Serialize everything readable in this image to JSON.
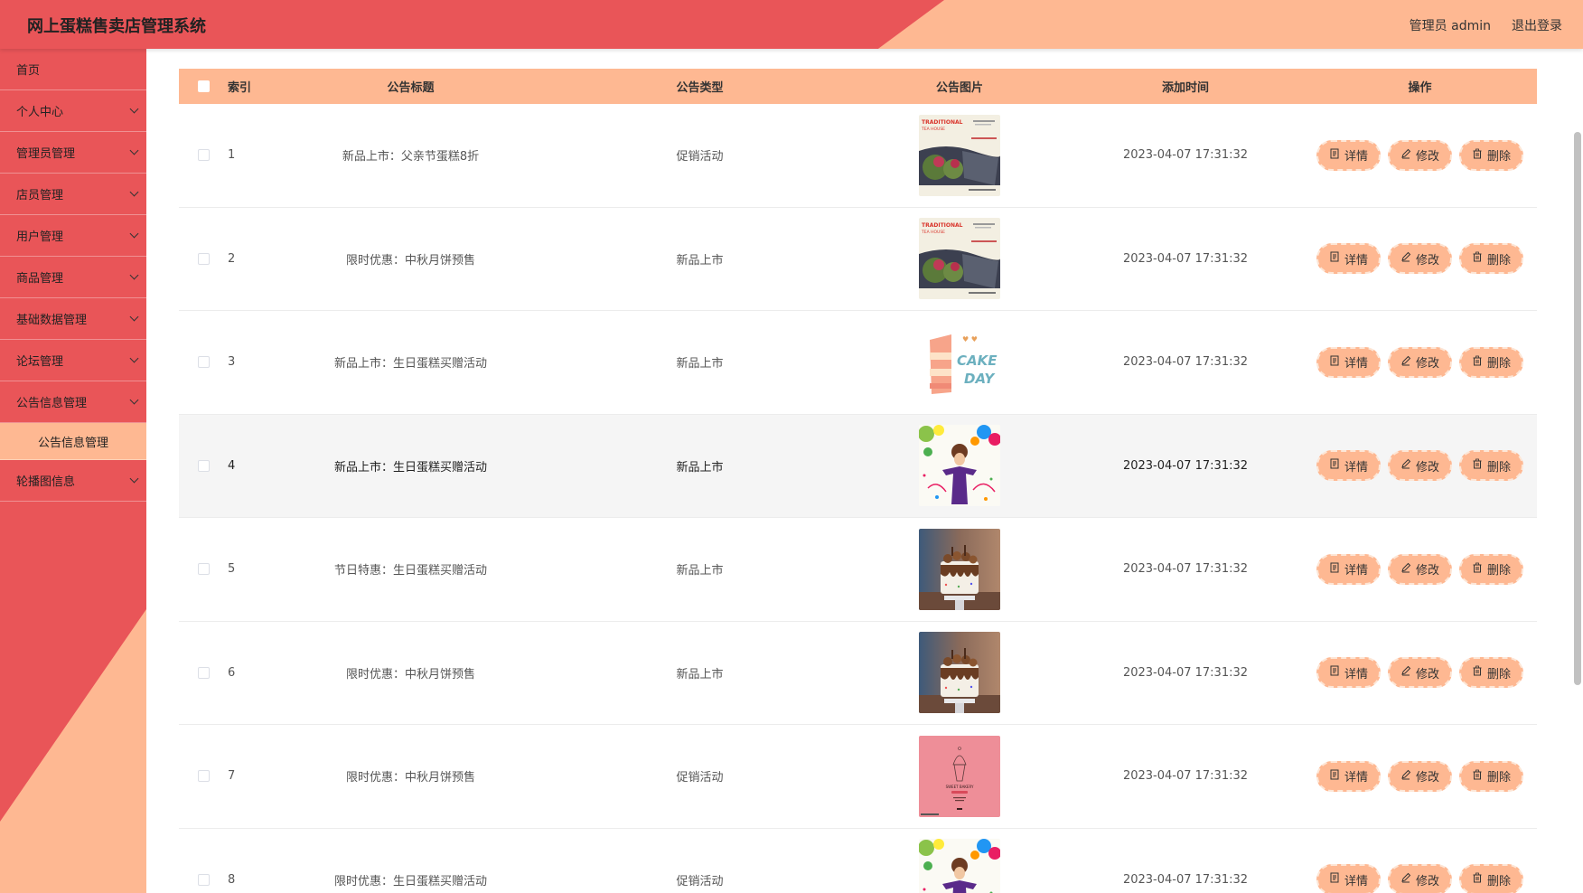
{
  "header": {
    "title": "网上蛋糕售卖店管理系统",
    "user": "管理员 admin",
    "logout": "退出登录"
  },
  "sidebar": {
    "items": [
      {
        "label": "首页",
        "has_children": false
      },
      {
        "label": "个人中心",
        "has_children": true
      },
      {
        "label": "管理员管理",
        "has_children": true
      },
      {
        "label": "店员管理",
        "has_children": true
      },
      {
        "label": "用户管理",
        "has_children": true
      },
      {
        "label": "商品管理",
        "has_children": true
      },
      {
        "label": "基础数据管理",
        "has_children": true
      },
      {
        "label": "论坛管理",
        "has_children": true
      },
      {
        "label": "公告信息管理",
        "has_children": true
      },
      {
        "label": "轮播图信息",
        "has_children": true
      }
    ],
    "submenu": {
      "label": "公告信息管理"
    }
  },
  "table": {
    "columns": [
      "索引",
      "公告标题",
      "公告类型",
      "公告图片",
      "添加时间",
      "操作"
    ],
    "rows": [
      {
        "index": "1",
        "title": "新品上市：父亲节蛋糕8折",
        "type": "促销活动",
        "image": "tea-house-poster",
        "time": "2023-04-07 17:31:32"
      },
      {
        "index": "2",
        "title": "限时优惠：中秋月饼预售",
        "type": "新品上市",
        "image": "tea-house-poster",
        "time": "2023-04-07 17:31:32"
      },
      {
        "index": "3",
        "title": "新品上市：生日蛋糕买赠活动",
        "type": "新品上市",
        "image": "cake-day-illustration",
        "time": "2023-04-07 17:31:32"
      },
      {
        "index": "4",
        "title": "新品上市：生日蛋糕买赠活动",
        "type": "新品上市",
        "image": "party-girl-photo",
        "time": "2023-04-07 17:31:32"
      },
      {
        "index": "5",
        "title": "节日特惠：生日蛋糕买赠活动",
        "type": "新品上市",
        "image": "chocolate-cake-photo",
        "time": "2023-04-07 17:31:32"
      },
      {
        "index": "6",
        "title": "限时优惠：中秋月饼预售",
        "type": "新品上市",
        "image": "chocolate-cake-photo",
        "time": "2023-04-07 17:31:32"
      },
      {
        "index": "7",
        "title": "限时优惠：中秋月饼预售",
        "type": "促销活动",
        "image": "pink-bakery-poster",
        "time": "2023-04-07 17:31:32"
      },
      {
        "index": "8",
        "title": "限时优惠：生日蛋糕买赠活动",
        "type": "促销活动",
        "image": "party-girl-photo",
        "time": "2023-04-07 17:31:32"
      }
    ],
    "highlighted_row": 3,
    "actions": {
      "detail": "详情",
      "edit": "修改",
      "delete": "删除"
    },
    "thumb_text": {
      "tea_title": "TRADITIONAL",
      "tea_subtitle": "TEA HOUSE",
      "cake_day_1": "CAKE",
      "cake_day_2": "DAY",
      "bakery": "SWEET BAKERY"
    }
  },
  "colors": {
    "primary_red": "#e95558",
    "peach": "#feb892",
    "row_highlight": "#f5f5f5"
  }
}
